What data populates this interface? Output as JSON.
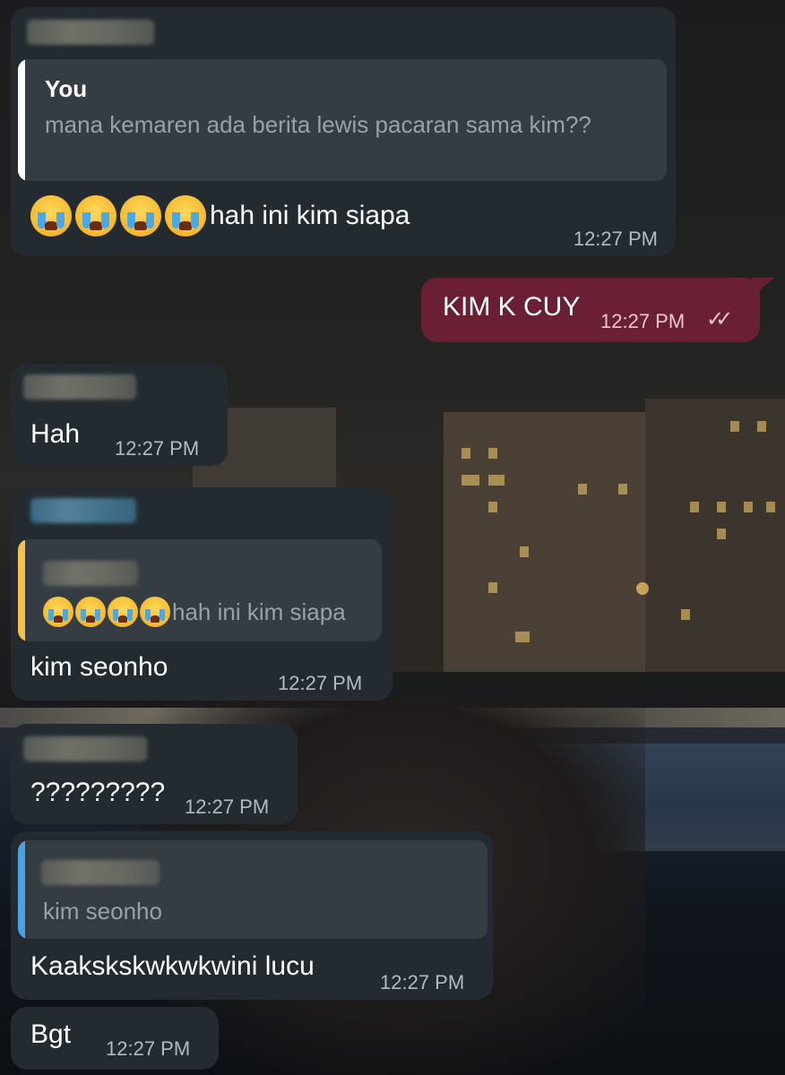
{
  "colors": {
    "incoming_bubble": "#232b31",
    "outgoing_bubble": "#6b1f35",
    "reply_card": "#353d43",
    "reply_bar_white": "#ffffff",
    "reply_bar_yellow": "#f2c14e",
    "reply_bar_blue": "#4aa3df"
  },
  "messages": [
    {
      "id": "m1",
      "direction": "incoming",
      "reply": {
        "name": "You",
        "text": "mana kemaren ada berita lewis pacaran sama kim??"
      },
      "emoji": [
        "loudly-crying-face-icon",
        "loudly-crying-face-icon",
        "loudly-crying-face-icon",
        "loudly-crying-face-icon"
      ],
      "text": "hah ini kim siapa",
      "time": "12:27 PM"
    },
    {
      "id": "m2",
      "direction": "outgoing",
      "text": "KIM K CUY",
      "time": "12:27 PM",
      "status_icon": "double-check-icon"
    },
    {
      "id": "m3",
      "direction": "incoming",
      "text": "Hah",
      "time": "12:27 PM"
    },
    {
      "id": "m4",
      "direction": "incoming",
      "reply": {
        "text": "hah ini kim siapa"
      },
      "reply_emoji": [
        "loudly-crying-face-icon",
        "loudly-crying-face-icon",
        "loudly-crying-face-icon",
        "loudly-crying-face-icon"
      ],
      "text": "kim seonho",
      "time": "12:27 PM"
    },
    {
      "id": "m5",
      "direction": "incoming",
      "text": "?????????",
      "time": "12:27 PM"
    },
    {
      "id": "m6",
      "direction": "incoming",
      "reply": {
        "text": "kim seonho"
      },
      "text": "Kaakskskwkwkwini lucu",
      "time": "12:27 PM"
    },
    {
      "id": "m7",
      "direction": "incoming",
      "text": "Bgt",
      "time": "12:27 PM"
    }
  ]
}
